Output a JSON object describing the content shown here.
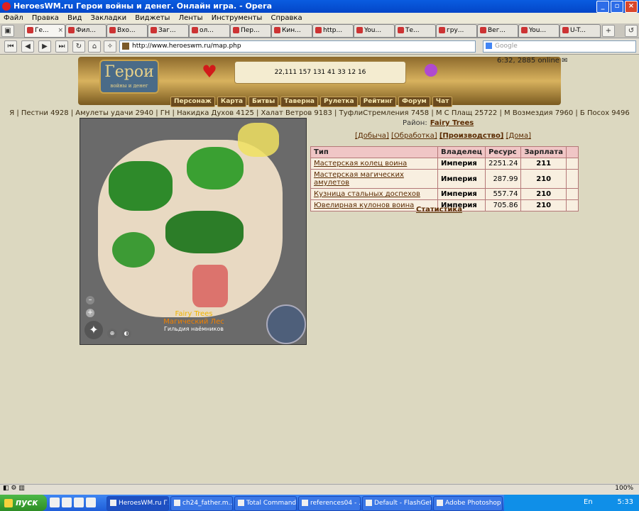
{
  "window": {
    "title": "HeroesWM.ru Герои войны и денег. Онлайн игра. - Opera"
  },
  "menu": [
    "Файл",
    "Правка",
    "Вид",
    "Закладки",
    "Виджеты",
    "Ленты",
    "Инструменты",
    "Справка"
  ],
  "tabs": [
    "Ге...",
    "Фил...",
    "Вхо...",
    "Заг...",
    "ол...",
    "Пер...",
    "Кин...",
    "http...",
    "You...",
    "Те...",
    "гру...",
    "Вег...",
    "You...",
    "U-T..."
  ],
  "address": {
    "url": "http://www.heroeswm.ru/map.php",
    "search_placeholder": "Google"
  },
  "banner": {
    "logo": "Герои",
    "logo_sub": "войны и денег",
    "resources": "22,111  157  131  41  33  12  16",
    "online": "6:32, 2885 online"
  },
  "nav": [
    "Персонаж",
    "Карта",
    "Битвы",
    "Таверна",
    "Рулетка",
    "Рейтинг",
    "Форум",
    "Чат"
  ],
  "inventory": "Я | Пестни 4928 | Амулеты удачи 2940 | ГН | Накидка Духов 4125 | Халат Ветров 9183 | ТуфлиСтремления 7458 | М С Плащ 25722 | М Возмездия 7960 | Б Посох 9496",
  "map": {
    "name_en": "Fairy Trees",
    "name_ru": "Магический Лес",
    "guild": "Гильдия наёмников",
    "zoom_minus": "–",
    "zoom_plus": "+",
    "compass": "✦",
    "ctl1": "⊕",
    "ctl2": "◐"
  },
  "district": {
    "label": "Район:",
    "name": "Fairy Trees"
  },
  "subtabs": [
    "[Добыча]",
    "[Обработка]",
    "[Производство]",
    "[Дома]"
  ],
  "table": {
    "headers": [
      "Тип",
      "Владелец",
      "Ресурс",
      "Зарплата",
      ""
    ],
    "rows": [
      {
        "name": "Мастерская колец воина",
        "owner": "Империя",
        "res": "2251.24",
        "salary": "211"
      },
      {
        "name": "Мастерская магических амулетов",
        "owner": "Империя",
        "res": "287.99",
        "salary": "210"
      },
      {
        "name": "Кузница стальных доспехов",
        "owner": "Империя",
        "res": "557.74",
        "salary": "210"
      },
      {
        "name": "Ювелирная кулонов воина",
        "owner": "Империя",
        "res": "705.86",
        "salary": "210"
      }
    ]
  },
  "stats_link": "Статистика",
  "status": {
    "zoom": "100%"
  },
  "taskbar": {
    "start": "пуск",
    "tasks": [
      "HeroesWM.ru Г...",
      "ch24_father.m...",
      "Total Command...",
      "references04 - ...",
      "Default - FlashGet",
      "Adobe Photoshop"
    ],
    "lang": "En",
    "clock": "5:33"
  }
}
